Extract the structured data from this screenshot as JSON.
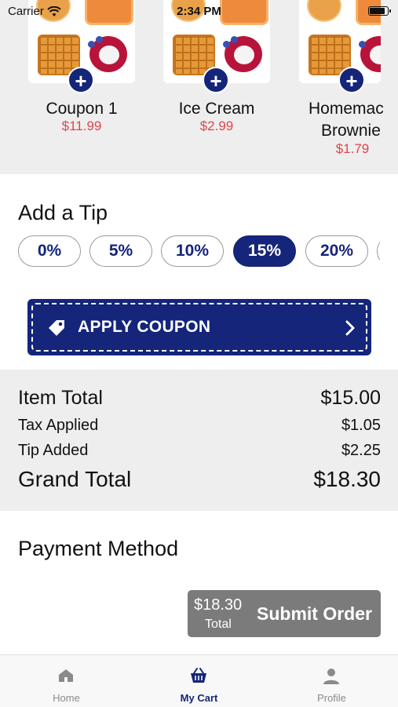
{
  "status_bar": {
    "carrier": "Carrier",
    "time": "2:34 PM"
  },
  "products": [
    {
      "name": "Coupon 1",
      "price": "$11.99"
    },
    {
      "name": "Ice Cream",
      "price": "$2.99"
    },
    {
      "name": "Homemade Brownie",
      "name_line1": "Homemac",
      "name_line2": "Brownie",
      "price": "$1.79"
    }
  ],
  "tip": {
    "title": "Add a Tip",
    "options": [
      "0%",
      "5%",
      "10%",
      "15%",
      "20%"
    ],
    "selected": "15%"
  },
  "coupon": {
    "label": "APPLY COUPON"
  },
  "totals": {
    "item_total_label": "Item Total",
    "item_total": "$15.00",
    "tax_label": "Tax Applied",
    "tax": "$1.05",
    "tip_label": "Tip Added",
    "tip": "$2.25",
    "grand_total_label": "Grand Total",
    "grand_total": "$18.30"
  },
  "payment": {
    "title": "Payment Method"
  },
  "submit": {
    "amount": "$18.30",
    "amount_caption": "Total",
    "label": "Submit Order"
  },
  "tabs": [
    {
      "label": "Home",
      "icon": "home-icon",
      "active": false
    },
    {
      "label": "My Cart",
      "icon": "basket-icon",
      "active": true
    },
    {
      "label": "Profile",
      "icon": "person-icon",
      "active": false
    }
  ],
  "colors": {
    "primary": "#14257a",
    "price": "#e0454a",
    "section_bg": "#eeeeef",
    "submit_disabled": "#7b7b7b"
  }
}
